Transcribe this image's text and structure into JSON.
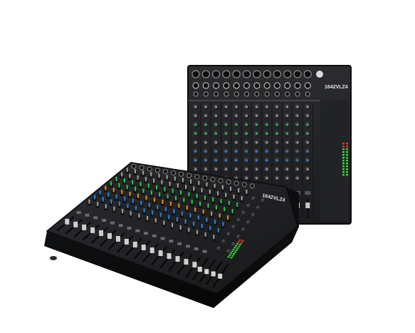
{
  "product": {
    "brand_front": "1642VLZ4",
    "brand_back": "1642VLZ4",
    "colors": {
      "background": "#ffffff",
      "chassis": "#1c1d1f",
      "panel": "#2a2b2e",
      "knob_green": "#2fbf4a",
      "knob_blue": "#2a7fd4",
      "knob_orange": "#e08a1e",
      "knob_gray": "#9a9a9a",
      "meter_green": "#3ad13a",
      "meter_red": "#d83a2a"
    }
  }
}
